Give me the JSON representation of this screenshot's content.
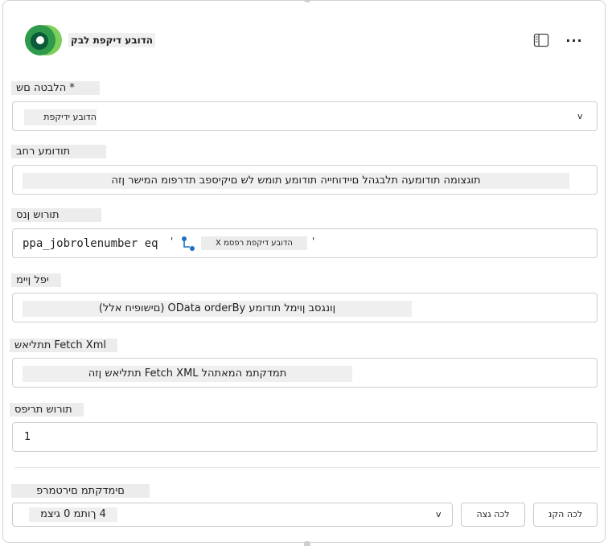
{
  "header": {
    "title": "הדובע דיקפת לבק",
    "panel_icon": "panel-icon",
    "more_icon": "more-icon",
    "more_glyph": "···"
  },
  "form": {
    "name": {
      "label": "* הלבטה םש",
      "value": "הדובע ידיקפת",
      "dropdown_glyph": "v"
    },
    "description": {
      "label": "תודומע רחב",
      "value": "תוגצומה תודומעה תלבגהל םיידוחייה תודומע תומש לש םיקיספב תדרפומ המישר ןזה"
    },
    "filter": {
      "label": "תורוש ןנס",
      "code_text": "ppa_jobrolenumber eq",
      "quote_open": "' ",
      "quote_close": "'",
      "token_icon": "flow-icon",
      "token_label": "הדובע דיקפת רפסמ X"
    },
    "sort": {
      "label": "יפל ןיימ",
      "value": "ןונגסב ןוימל תודומע OData orderBy (םישופיח אלל)"
    },
    "fetch_xml": {
      "label": "Fetch Xml תתליאש",
      "value": "תמדקתמ המאתהל Fetch XML תתליאש ןזה"
    },
    "row_count": {
      "label": "תורוש תריפס",
      "value": "1"
    },
    "advanced": {
      "label": "םימדקתמ םירטמרפ",
      "value": "4 ךותמ 0 גיצמ",
      "dropdown_glyph": "v"
    }
  },
  "buttons": {
    "show_all": "לכה גצה",
    "clear_all": "לכה הקנ"
  },
  "colors": {
    "logo_dark": "#0b5a3a",
    "logo_mid": "#2f9a4b",
    "logo_light": "#7ccf5a",
    "token_icon": "#1e6fc2"
  }
}
